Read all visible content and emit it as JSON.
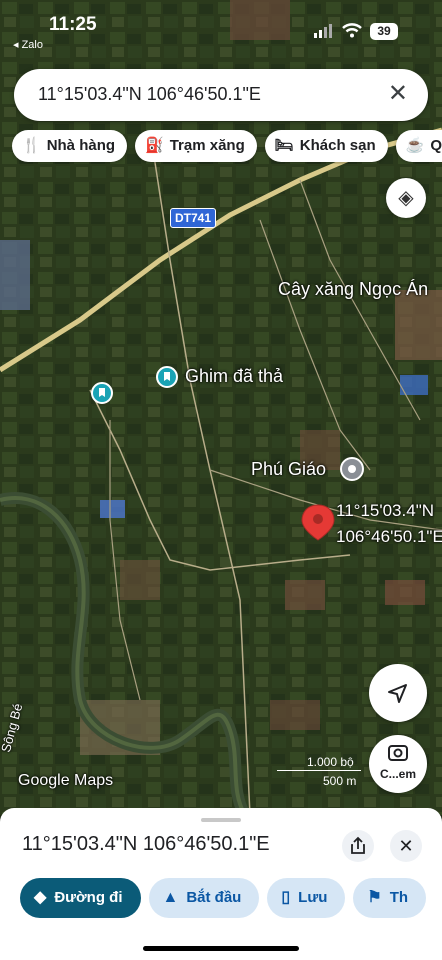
{
  "status": {
    "time": "11:25",
    "back_app": "◂ Zalo",
    "battery": "39"
  },
  "search": {
    "query": "11°15'03.4\"N 106°46'50.1\"E"
  },
  "chips": [
    {
      "icon": "restaurant-icon",
      "label": "Nhà hàng"
    },
    {
      "icon": "gas-station-icon",
      "label": "Trạm xăng"
    },
    {
      "icon": "hotel-icon",
      "label": "Khách sạn"
    },
    {
      "icon": "coffee-icon",
      "label": "Qu"
    }
  ],
  "map": {
    "road_badge": "DT741",
    "labels": {
      "gas_station": "Cây xăng Ngọc Án",
      "pin_dropped": "Ghim đã thả",
      "place": "Phú Giáo",
      "pin_coord_1": "11°15'03.4\"N",
      "pin_coord_2": "106°46'50.1\"E",
      "river": "Sông Bé"
    },
    "attribution": "Google Maps",
    "scale": {
      "top": "1.000 bộ",
      "bottom": "500 m"
    },
    "camera_label": "C...em"
  },
  "sheet": {
    "title": "11°15'03.4\"N 106°46'50.1\"E",
    "actions": [
      {
        "icon": "directions-icon",
        "label": "Đường đi"
      },
      {
        "icon": "navigation-arrow-icon",
        "label": "Bắt đầu"
      },
      {
        "icon": "bookmark-icon",
        "label": "Lưu"
      },
      {
        "icon": "flag-icon",
        "label": "Th"
      }
    ]
  },
  "colors": {
    "primary": "#0b5b78",
    "tonal": "#d6e6f5",
    "pin": "#e53935"
  }
}
